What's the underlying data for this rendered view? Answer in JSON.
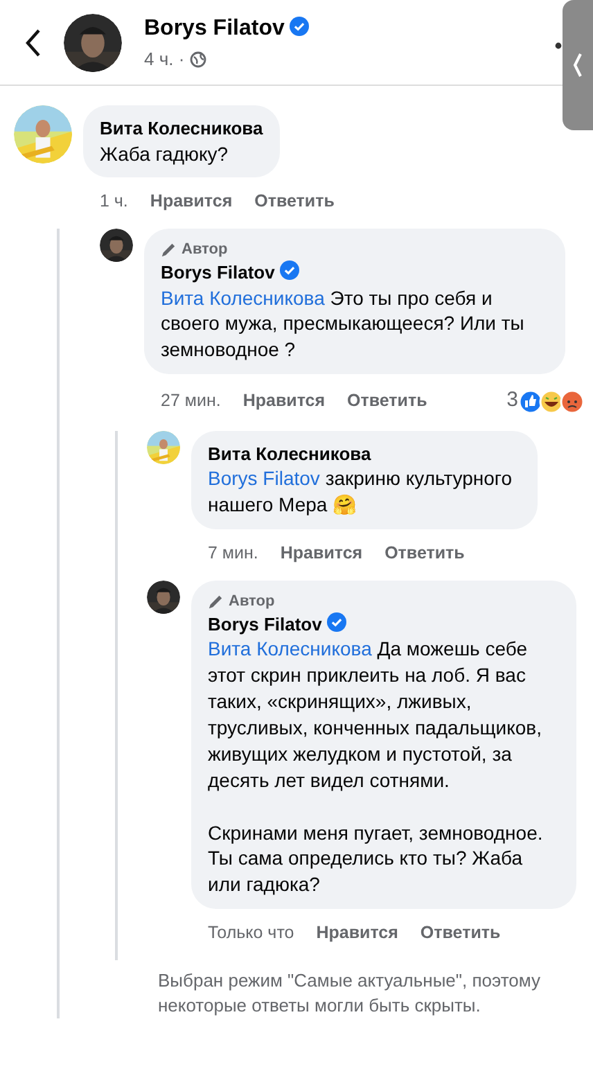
{
  "header": {
    "name": "Borys Filatov",
    "verified": true,
    "meta": "4 ч. ·"
  },
  "comments": [
    {
      "name": "Вита Колесникова",
      "verified": false,
      "text": [
        "Жаба гадюку?"
      ],
      "time": "1 ч.",
      "actions": [
        "Нравится",
        "Ответить"
      ],
      "children": [
        {
          "author_badge": "Автор",
          "name": "Borys Filatov",
          "verified": true,
          "mention": "Вита Колесникова",
          "text": [
            "Это ты про себя и своего мужа, пресмыкающееся? Или ты земноводное ?"
          ],
          "time": "27 мин.",
          "actions": [
            "Нравится",
            "Ответить"
          ],
          "reactions": "3",
          "children": [
            {
              "name": "Вита Колесникова",
              "verified": false,
              "mention": "Borys Filatov",
              "text": [
                "закриню культурного нашего Мера"
              ],
              "emoji": "🤗",
              "time": "7 мин.",
              "actions": [
                "Нравится",
                "Ответить"
              ]
            },
            {
              "author_badge": "Автор",
              "name": "Borys Filatov",
              "verified": true,
              "mention": "Вита Колесникова",
              "text": [
                "Да можешь себе этот скрин приклеить на лоб. Я вас таких, «скринящих», лживых, трусливых, конченных падальщиков, живущих желудком и пустотой, за десять лет видел сотнями.",
                "Скринами меня пугает, земноводное. Ты сама определись кто ты? Жаба или гадюка?"
              ],
              "time": "Только что",
              "actions": [
                "Нравится",
                "Ответить"
              ]
            }
          ]
        }
      ]
    }
  ],
  "note": "Выбран режим \"Самые актуальные\", поэтому некоторые ответы могли быть скрыты."
}
